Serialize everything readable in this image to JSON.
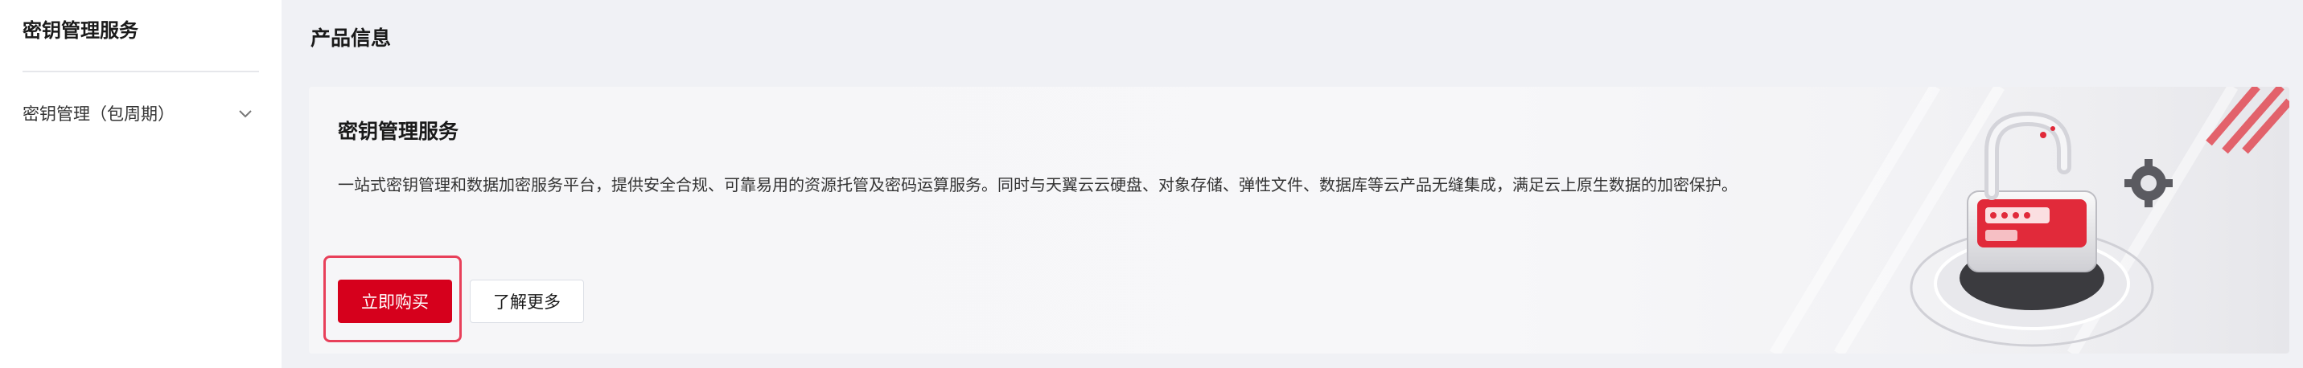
{
  "sidebar": {
    "title": "密钥管理服务",
    "items": [
      {
        "label": "密钥管理（包周期）",
        "icon": "chevron-down-icon"
      }
    ]
  },
  "main": {
    "title": "产品信息"
  },
  "product_card": {
    "title": "密钥管理服务",
    "description": "一站式密钥管理和数据加密服务平台，提供安全合规、可靠易用的资源托管及密码运算服务。同时与天翼云云硬盘、对象存储、弹性文件、数据库等云产品无缝集成，满足云上原生数据的加密保护。",
    "buy_button_label": "立即购买",
    "learn_more_label": "了解更多",
    "illustration": "padlock-illustration"
  },
  "colors": {
    "accent": "#d6001c",
    "highlight_border": "#e8405a",
    "background": "#f0f1f5"
  }
}
